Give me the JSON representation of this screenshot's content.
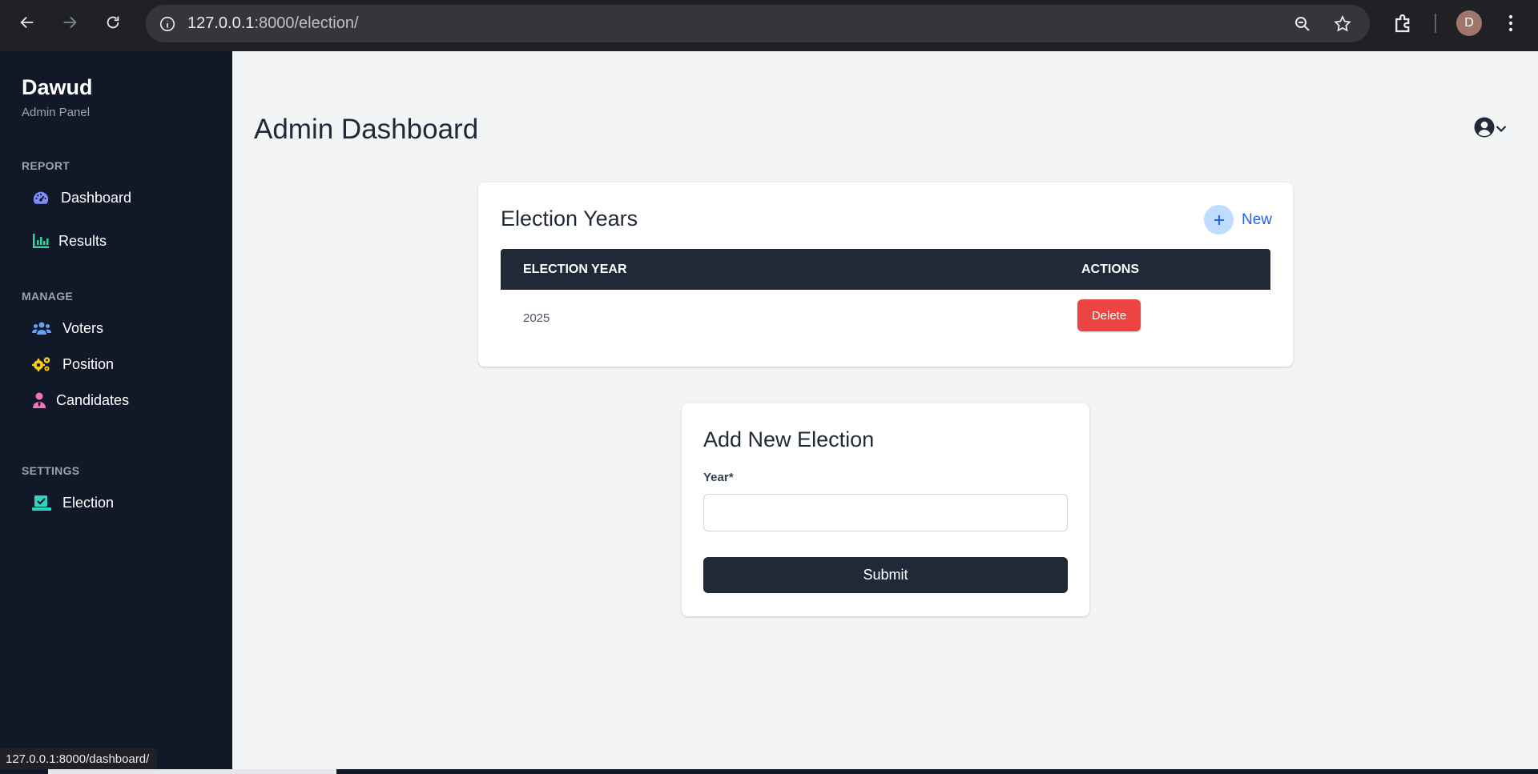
{
  "browser": {
    "url_host": "127.0.0.1",
    "url_path": ":8000/election/",
    "profile_initial": "D",
    "status_url": "127.0.0.1:8000/dashboard/"
  },
  "sidebar": {
    "brand": "Dawud",
    "subtitle": "Admin Panel",
    "sections": [
      {
        "title": "REPORT",
        "items": [
          {
            "label": "Dashboard",
            "icon": "gauge-icon",
            "color": "#818cf8"
          },
          {
            "label": "Results",
            "icon": "bar-chart-icon",
            "color": "#34d399"
          }
        ]
      },
      {
        "title": "MANAGE",
        "items": [
          {
            "label": "Voters",
            "icon": "users-icon",
            "color": "#60a5fa"
          },
          {
            "label": "Position",
            "icon": "gears-icon",
            "color": "#facc15"
          },
          {
            "label": "Candidates",
            "icon": "user-tie-icon",
            "color": "#f472b6"
          }
        ]
      },
      {
        "title": "SETTINGS",
        "items": [
          {
            "label": "Election",
            "icon": "vote-box-icon",
            "color": "#2dd4bf"
          }
        ]
      }
    ]
  },
  "main": {
    "page_title": "Admin Dashboard",
    "election_years": {
      "title": "Election Years",
      "new_label": "New",
      "columns": [
        "ELECTION YEAR",
        "ACTIONS"
      ],
      "rows": [
        {
          "year": "2025",
          "action": "Delete"
        }
      ]
    },
    "add_election": {
      "title": "Add New Election",
      "year_label": "Year*",
      "year_value": "",
      "submit_label": "Submit"
    }
  },
  "colors": {
    "sidebar_bg": "#111827",
    "header_bg": "#1f2937",
    "delete": "#ef4444",
    "accent": "#2563eb"
  }
}
